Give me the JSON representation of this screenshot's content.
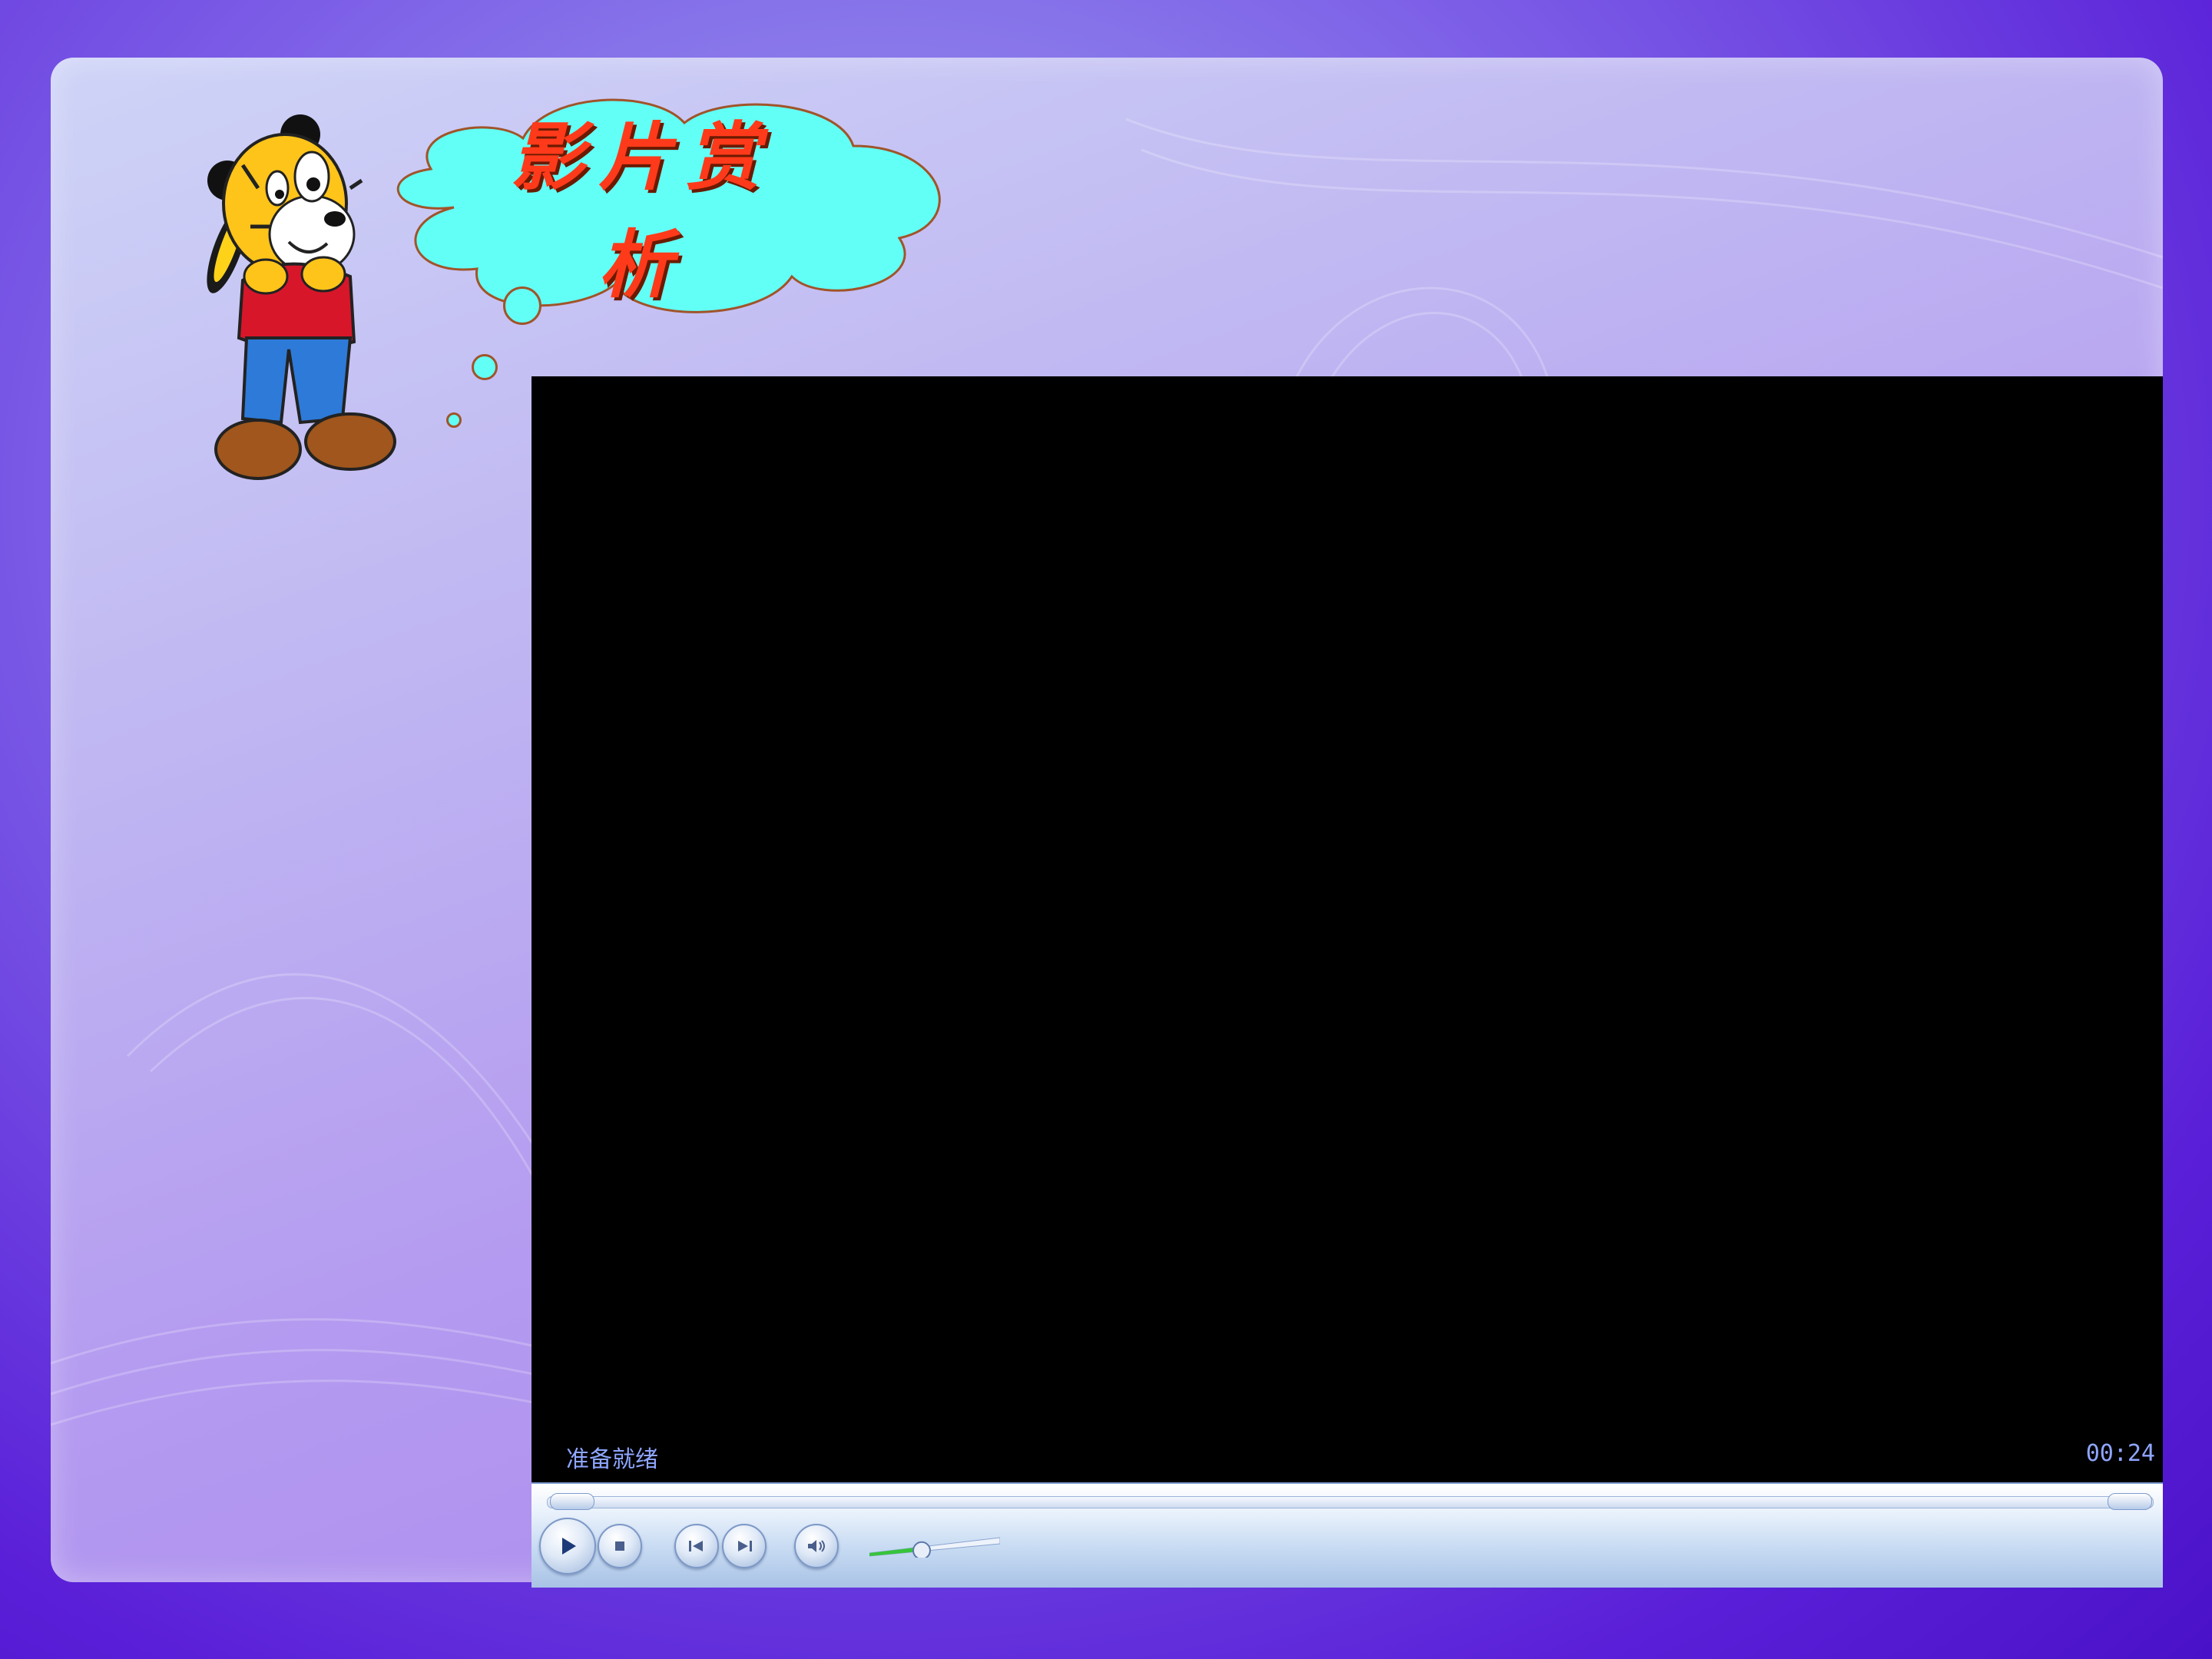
{
  "slide": {
    "title": "影片赏析",
    "title_color": "#ff3a1a",
    "cloud_color": "#62fff6",
    "mascot": "tiger-cartoon"
  },
  "player": {
    "status": "准备就绪",
    "time": "00:24",
    "volume_level": 0.4,
    "controls": {
      "play": "play-icon",
      "stop": "stop-icon",
      "previous": "previous-icon",
      "next": "next-icon",
      "mute": "speaker-icon"
    }
  }
}
